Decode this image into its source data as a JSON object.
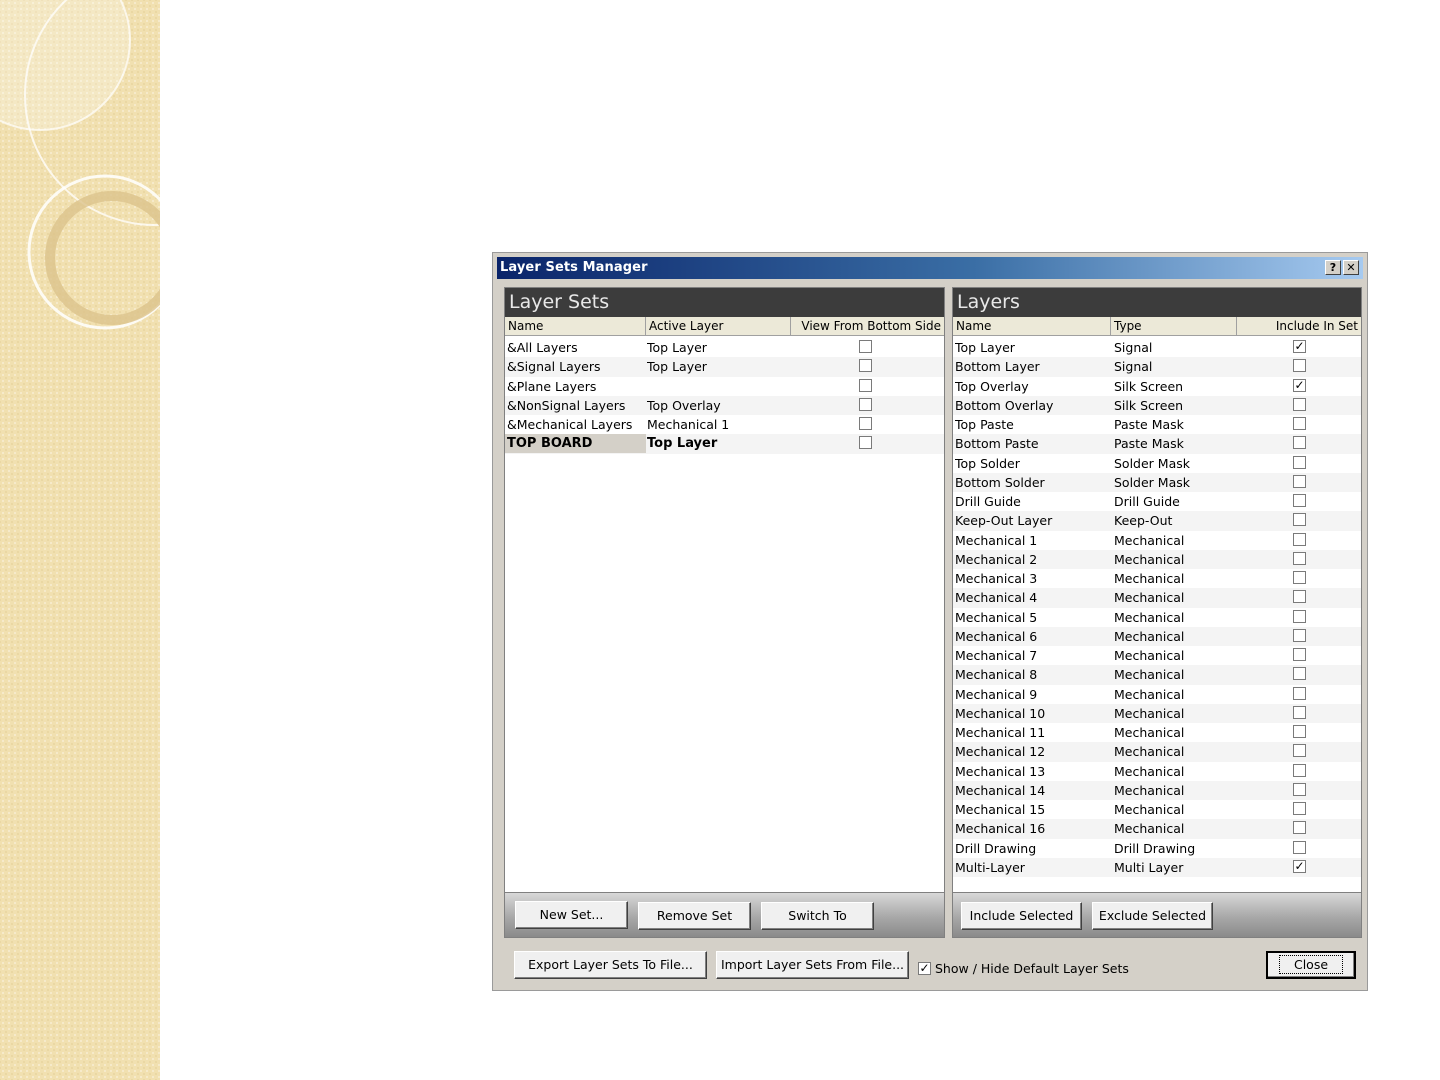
{
  "window": {
    "title": "Layer Sets Manager",
    "help_label": "?",
    "close_label": "✕"
  },
  "layer_sets": {
    "header": "Layer Sets",
    "columns": [
      "Name",
      "Active Layer",
      "View From Bottom Side"
    ],
    "rows": [
      {
        "name": "&All Layers",
        "active_layer": "Top Layer",
        "view_from_bottom": false
      },
      {
        "name": "&Signal Layers",
        "active_layer": "Top Layer",
        "view_from_bottom": false
      },
      {
        "name": "&Plane Layers",
        "active_layer": "",
        "view_from_bottom": false
      },
      {
        "name": "&NonSignal Layers",
        "active_layer": "Top Overlay",
        "view_from_bottom": false
      },
      {
        "name": "&Mechanical Layers",
        "active_layer": "Mechanical 1",
        "view_from_bottom": false
      },
      {
        "name": "TOP BOARD",
        "active_layer": "Top Layer",
        "view_from_bottom": false,
        "selected": true
      }
    ],
    "buttons": {
      "new_set": "New Set...",
      "remove_set": "Remove Set",
      "switch_to": "Switch To"
    }
  },
  "layers": {
    "header": "Layers",
    "columns": [
      "Name",
      "Type",
      "Include In Set"
    ],
    "rows": [
      {
        "name": "Top Layer",
        "type": "Signal",
        "include": true
      },
      {
        "name": "Bottom Layer",
        "type": "Signal",
        "include": false
      },
      {
        "name": "Top Overlay",
        "type": "Silk Screen",
        "include": true
      },
      {
        "name": "Bottom Overlay",
        "type": "Silk Screen",
        "include": false
      },
      {
        "name": "Top Paste",
        "type": "Paste Mask",
        "include": false
      },
      {
        "name": "Bottom Paste",
        "type": "Paste Mask",
        "include": false
      },
      {
        "name": "Top Solder",
        "type": "Solder Mask",
        "include": false
      },
      {
        "name": "Bottom Solder",
        "type": "Solder Mask",
        "include": false
      },
      {
        "name": "Drill Guide",
        "type": "Drill Guide",
        "include": false
      },
      {
        "name": "Keep-Out Layer",
        "type": "Keep-Out",
        "include": false
      },
      {
        "name": "Mechanical 1",
        "type": "Mechanical",
        "include": false
      },
      {
        "name": "Mechanical 2",
        "type": "Mechanical",
        "include": false
      },
      {
        "name": "Mechanical 3",
        "type": "Mechanical",
        "include": false
      },
      {
        "name": "Mechanical 4",
        "type": "Mechanical",
        "include": false
      },
      {
        "name": "Mechanical 5",
        "type": "Mechanical",
        "include": false
      },
      {
        "name": "Mechanical 6",
        "type": "Mechanical",
        "include": false
      },
      {
        "name": "Mechanical 7",
        "type": "Mechanical",
        "include": false
      },
      {
        "name": "Mechanical 8",
        "type": "Mechanical",
        "include": false
      },
      {
        "name": "Mechanical 9",
        "type": "Mechanical",
        "include": false
      },
      {
        "name": "Mechanical 10",
        "type": "Mechanical",
        "include": false
      },
      {
        "name": "Mechanical 11",
        "type": "Mechanical",
        "include": false
      },
      {
        "name": "Mechanical 12",
        "type": "Mechanical",
        "include": false
      },
      {
        "name": "Mechanical 13",
        "type": "Mechanical",
        "include": false
      },
      {
        "name": "Mechanical 14",
        "type": "Mechanical",
        "include": false
      },
      {
        "name": "Mechanical 15",
        "type": "Mechanical",
        "include": false
      },
      {
        "name": "Mechanical 16",
        "type": "Mechanical",
        "include": false
      },
      {
        "name": "Drill Drawing",
        "type": "Drill Drawing",
        "include": false
      },
      {
        "name": "Multi-Layer",
        "type": "Multi Layer",
        "include": true
      }
    ],
    "buttons": {
      "include_selected": "Include Selected",
      "exclude_selected": "Exclude Selected"
    }
  },
  "bottom_bar": {
    "export_label": "Export Layer Sets To File...",
    "import_label": "Import Layer Sets From File...",
    "show_hide_label": "Show / Hide Default Layer Sets",
    "show_hide_checked": true,
    "close_label": "Close"
  },
  "colors": {
    "title_start": "#0a246a",
    "title_end": "#a6caf0",
    "panel_header": "#3c3c3c",
    "dialog_face": "#d4d0c8"
  }
}
